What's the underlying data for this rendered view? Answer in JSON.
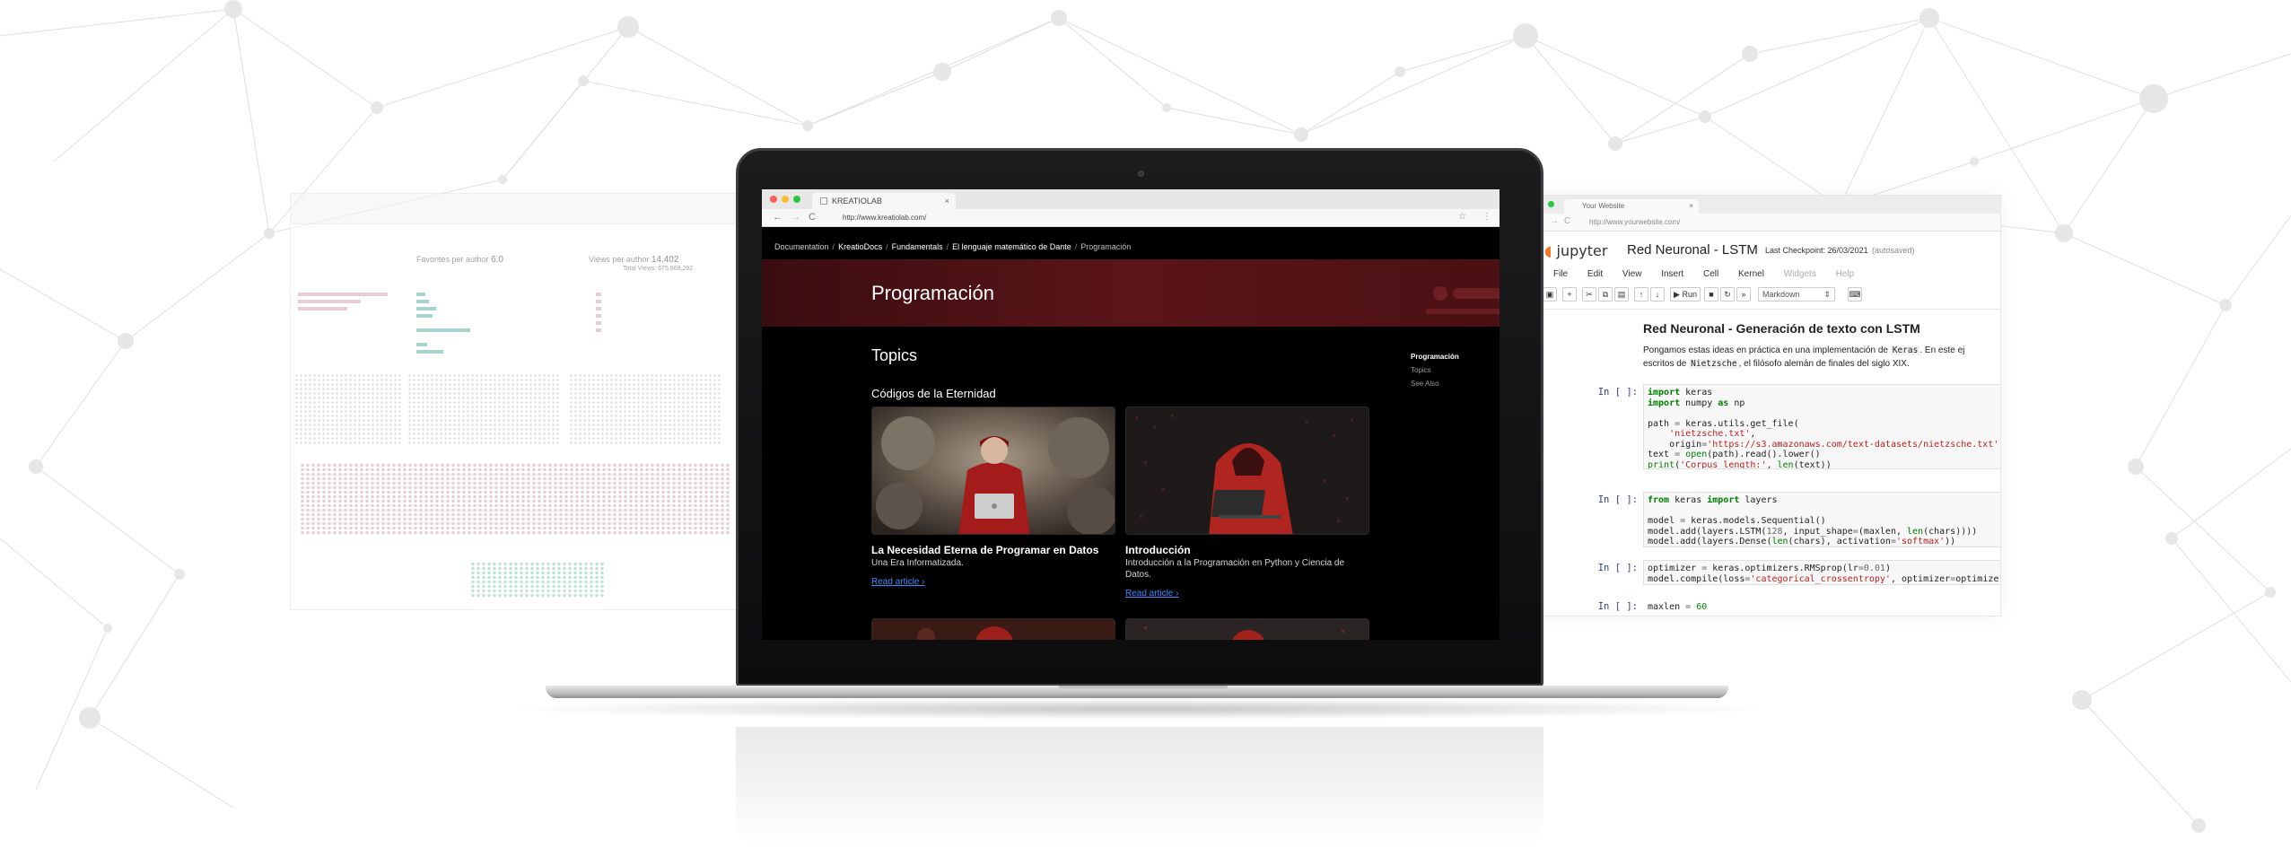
{
  "laptop_browser": {
    "tab_title": "KREATIOLAB",
    "tab_close": "×",
    "url": "http://www.kreatiolab.com/",
    "nav_back": "←",
    "nav_forward": "→",
    "nav_reload": "C",
    "bookmark": "☆",
    "menu": "⋮",
    "breadcrumbs": [
      "Documentation",
      "KreatioDocs",
      "Fundamentals",
      "El lenguaje matemático de Dante",
      "Programación"
    ],
    "breadcrumb_sep": "/",
    "page_title": "Programación",
    "topics_heading": "Topics",
    "section_heading": "Códigos de la Eternidad",
    "toc": [
      "Programación",
      "Topics",
      "See Also"
    ],
    "cards": [
      {
        "title": "La Necesidad Eterna de Programar en Datos",
        "description": "Una Era Informatizada.",
        "link": "Read article ›"
      },
      {
        "title": "Introducción",
        "description": "Introducción a la Programación en Python y Ciencia de Datos.",
        "link": "Read article ›"
      }
    ]
  },
  "jupyter_window": {
    "tab_title": "Your Website",
    "tab_close": "×",
    "url": "http://www.yourwebsite.com/",
    "logo_text": "jupyter",
    "notebook_title": "Red Neuronal - LSTM",
    "checkpoint": "Last Checkpoint: 26/03/2021",
    "autosaved": "(autosaved)",
    "menu": [
      "File",
      "Edit",
      "View",
      "Insert",
      "Cell",
      "Kernel",
      "Widgets",
      "Help"
    ],
    "toolbar": {
      "run_label": "Run",
      "cell_type": "Markdown"
    },
    "markdown_heading": "Red Neuronal - Generación de texto con LSTM",
    "markdown_line1_a": "Pongamos estas ideas en práctica en una implementación de",
    "markdown_line1_code": "Keras",
    "markdown_line1_b": ". En este ej",
    "markdown_line2_a": "escritos de",
    "markdown_line2_code": "Nietzsche",
    "markdown_line2_b": ", el filósofo alemán de finales del siglo XIX.",
    "cells": [
      {
        "prompt": "In [ ]:"
      },
      {
        "prompt": "In [ ]:"
      },
      {
        "prompt": "In [ ]:"
      },
      {
        "prompt": "In [ ]:"
      }
    ]
  },
  "dashboard_window": {
    "stat1_label": "Favorites per author",
    "stat1_value": "6.0",
    "stat2_label": "Views per author",
    "stat2_value": "14,402",
    "stat2_sub": "Total Views: 675,868,292"
  },
  "colors": {
    "accent_link": "#3f8cff",
    "hero_red": "#5b1519",
    "jupyter_orange": "#f37726"
  }
}
